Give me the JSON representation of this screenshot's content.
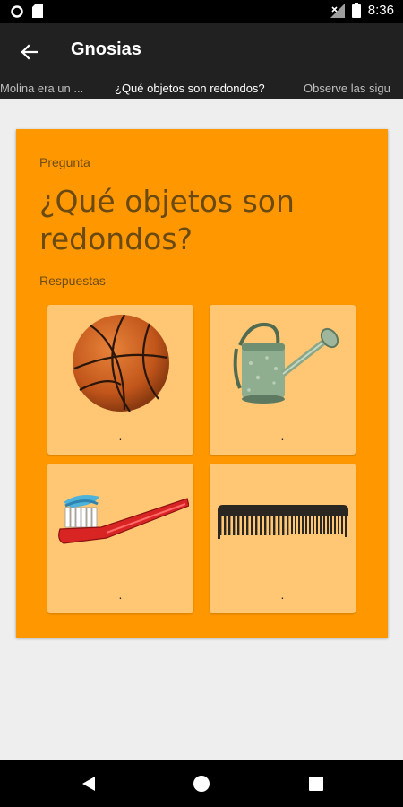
{
  "status_bar": {
    "time": "8:36",
    "icons": [
      "circle-notification-icon",
      "sd-card-icon",
      "no-signal-icon",
      "battery-icon"
    ]
  },
  "app_bar": {
    "title": "Gnosias",
    "back_icon": "arrow-back-icon"
  },
  "tabs": [
    {
      "label": "Molina era un ...",
      "active": false
    },
    {
      "label": "¿Qué objetos son redondos?",
      "active": true
    },
    {
      "label": "Observe las sigu",
      "active": false
    }
  ],
  "card": {
    "question_label": "Pregunta",
    "question": "¿Qué objetos son redondos?",
    "answers_label": "Respuestas",
    "background_color": "#ff9800",
    "answers": [
      {
        "image": "basketball",
        "caption": "."
      },
      {
        "image": "watering-can",
        "caption": "."
      },
      {
        "image": "toothbrush",
        "caption": "."
      },
      {
        "image": "comb",
        "caption": "."
      }
    ]
  },
  "nav_bar": {
    "icons": [
      "back-triangle-icon",
      "home-circle-icon",
      "recents-square-icon"
    ]
  }
}
